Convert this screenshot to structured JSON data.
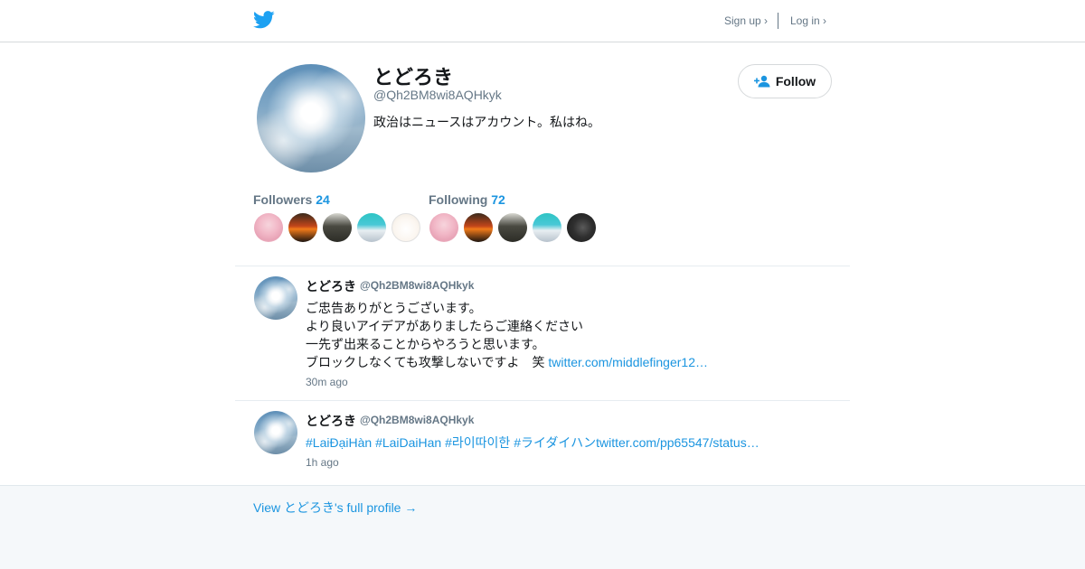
{
  "header": {
    "signup_label": "Sign up ›",
    "login_label": "Log in ›",
    "logo_icon": "twitter-bird-icon",
    "brand_color": "#1da1f2"
  },
  "profile": {
    "name": "とどろき",
    "handle": "@Qh2BM8wi8AQHkyk",
    "bio": "政治はニュースはアカウント。私はね。",
    "follow_label": "Follow",
    "followers_label": "Followers",
    "followers_count": "24",
    "following_label": "Following",
    "following_count": "72"
  },
  "tweets": [
    {
      "name": "とどろき",
      "handle": "@Qh2BM8wi8AQHkyk",
      "lines": [
        "ご忠告ありがとうございます。",
        "より良いアイデアがありましたらご連絡ください",
        "一先ず出来ることからやろうと思います。",
        "ブロックしなくても攻撃しないですよ　笑 "
      ],
      "link": "twitter.com/middlefinger12…",
      "time": "30m ago"
    },
    {
      "name": "とどろき",
      "handle": "@Qh2BM8wi8AQHkyk",
      "tags": [
        "#LaiĐạiHàn",
        "#LaiDaiHan",
        "#라이따이한",
        "#ライダイハン"
      ],
      "link": "twitter.com/pp65547/status…",
      "time": "1h ago"
    }
  ],
  "footer": {
    "full_profile_link": "View とどろき's full profile →"
  },
  "colors": {
    "accent": "#1b95e0",
    "muted": "#657786",
    "footer_bg": "#f5f8fa"
  }
}
